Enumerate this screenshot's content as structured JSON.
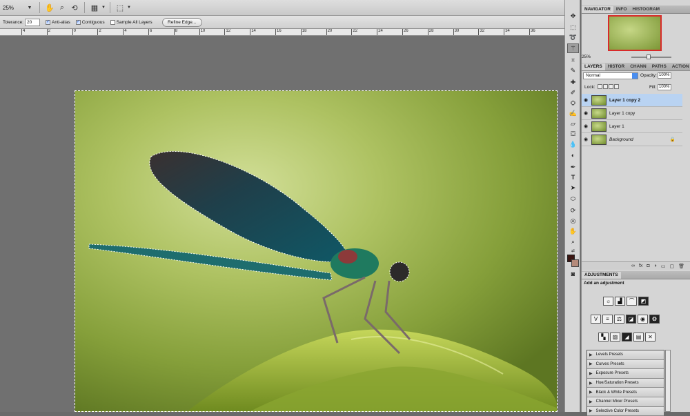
{
  "app_bar": {
    "zoom_level": "25%",
    "icons": [
      "hand-tool-icon",
      "zoom-tool-icon",
      "rotate-view-icon",
      "arrange-documents-icon",
      "screen-mode-icon"
    ]
  },
  "options_bar": {
    "tolerance_label": "Tolerance:",
    "tolerance_value": "20",
    "anti_alias_label": "Anti-alias",
    "anti_alias_checked": true,
    "contiguous_label": "Contiguous",
    "contiguous_checked": true,
    "sample_all_label": "Sample All Layers",
    "sample_all_checked": false,
    "refine_edge_label": "Refine Edge..."
  },
  "ruler": {
    "ticks": [
      "4",
      "2",
      "0",
      "2",
      "4",
      "6",
      "8",
      "10",
      "12",
      "14",
      "16",
      "18",
      "20",
      "22",
      "24",
      "26",
      "28",
      "30",
      "32",
      "34",
      "36"
    ]
  },
  "navigator_panel": {
    "tabs": [
      "NAVIGATOR",
      "INFO",
      "HISTOGRAM"
    ],
    "zoom": "25%"
  },
  "layers_panel": {
    "tabs": [
      "LAYERS",
      "HISTOR",
      "CHANN",
      "PATHS",
      "ACTION"
    ],
    "blend_mode": "Normal",
    "opacity_label": "Opacity:",
    "opacity_value": "100%",
    "lock_label": "Lock:",
    "fill_label": "Fill:",
    "fill_value": "100%",
    "layers": [
      {
        "name": "Layer 1 copy 2",
        "selected": true
      },
      {
        "name": "Layer 1 copy",
        "selected": false
      },
      {
        "name": "Layer 1",
        "selected": false
      },
      {
        "name": "Background",
        "selected": false
      }
    ]
  },
  "adjustments_panel": {
    "tab": "ADJUSTMENTS",
    "heading": "Add an adjustment",
    "presets": [
      "Levels Presets",
      "Curves Presets",
      "Exposure Presets",
      "Hue/Saturation Presets",
      "Black & White Presets",
      "Channel Mixer Presets",
      "Selective Color Presets"
    ]
  },
  "colors": {
    "foreground": "#3b1612",
    "background": "#b58a7a",
    "selection_accent": "#b9d3f2"
  }
}
